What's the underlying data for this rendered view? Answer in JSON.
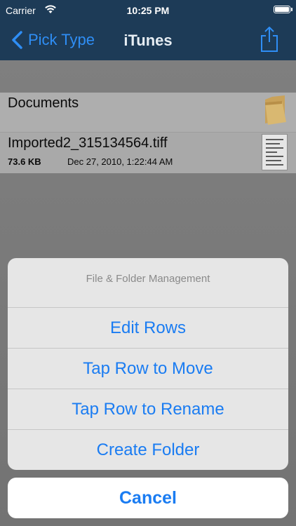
{
  "status_bar": {
    "carrier": "Carrier",
    "time": "10:25 PM",
    "wifi_icon": "wifi-icon",
    "battery_icon": "battery-icon"
  },
  "nav": {
    "back_label": "Pick Type",
    "title": "iTunes",
    "share_icon": "share-icon",
    "back_icon": "chevron-left-icon"
  },
  "files": [
    {
      "name": "Documents",
      "icon": "folder-icon"
    },
    {
      "name": "Imported2_315134564.tiff",
      "size": "73.6 KB",
      "date": "Dec 27, 2010, 1:22:44 AM",
      "icon": "document-thumbnail-icon"
    }
  ],
  "action_sheet": {
    "title": "File & Folder Management",
    "items": [
      "Edit Rows",
      "Tap Row to Move",
      "Tap Row to Rename",
      "Create Folder"
    ],
    "cancel": "Cancel"
  },
  "colors": {
    "nav_background": "#1d3b57",
    "accent": "#1a7cf2",
    "back_accent": "#2f8ef5"
  }
}
